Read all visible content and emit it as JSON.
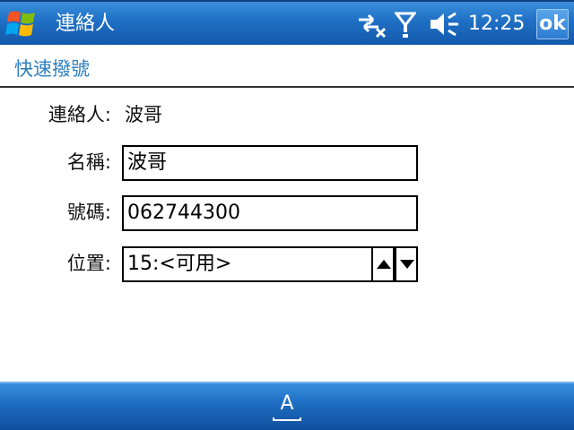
{
  "titlebar": {
    "app_title": "連絡人",
    "time": "12:25",
    "ok_label": "ok",
    "icons": [
      "windows-start-icon",
      "connectivity-icon",
      "signal-strength-icon",
      "volume-icon"
    ]
  },
  "header": {
    "title": "快速撥號"
  },
  "form": {
    "contact_label": "連絡人:",
    "contact_value": "波哥",
    "name_label": "名稱:",
    "name_value": "波哥",
    "number_label": "號碼:",
    "number_value": "062744300",
    "position_label": "位置:",
    "position_value": "15:<可用>"
  },
  "bottom_bar": {
    "input_panel_label": "A"
  },
  "colors": {
    "titlebar_blue": "#1f6fc4",
    "header_text": "#2c7fbf"
  }
}
